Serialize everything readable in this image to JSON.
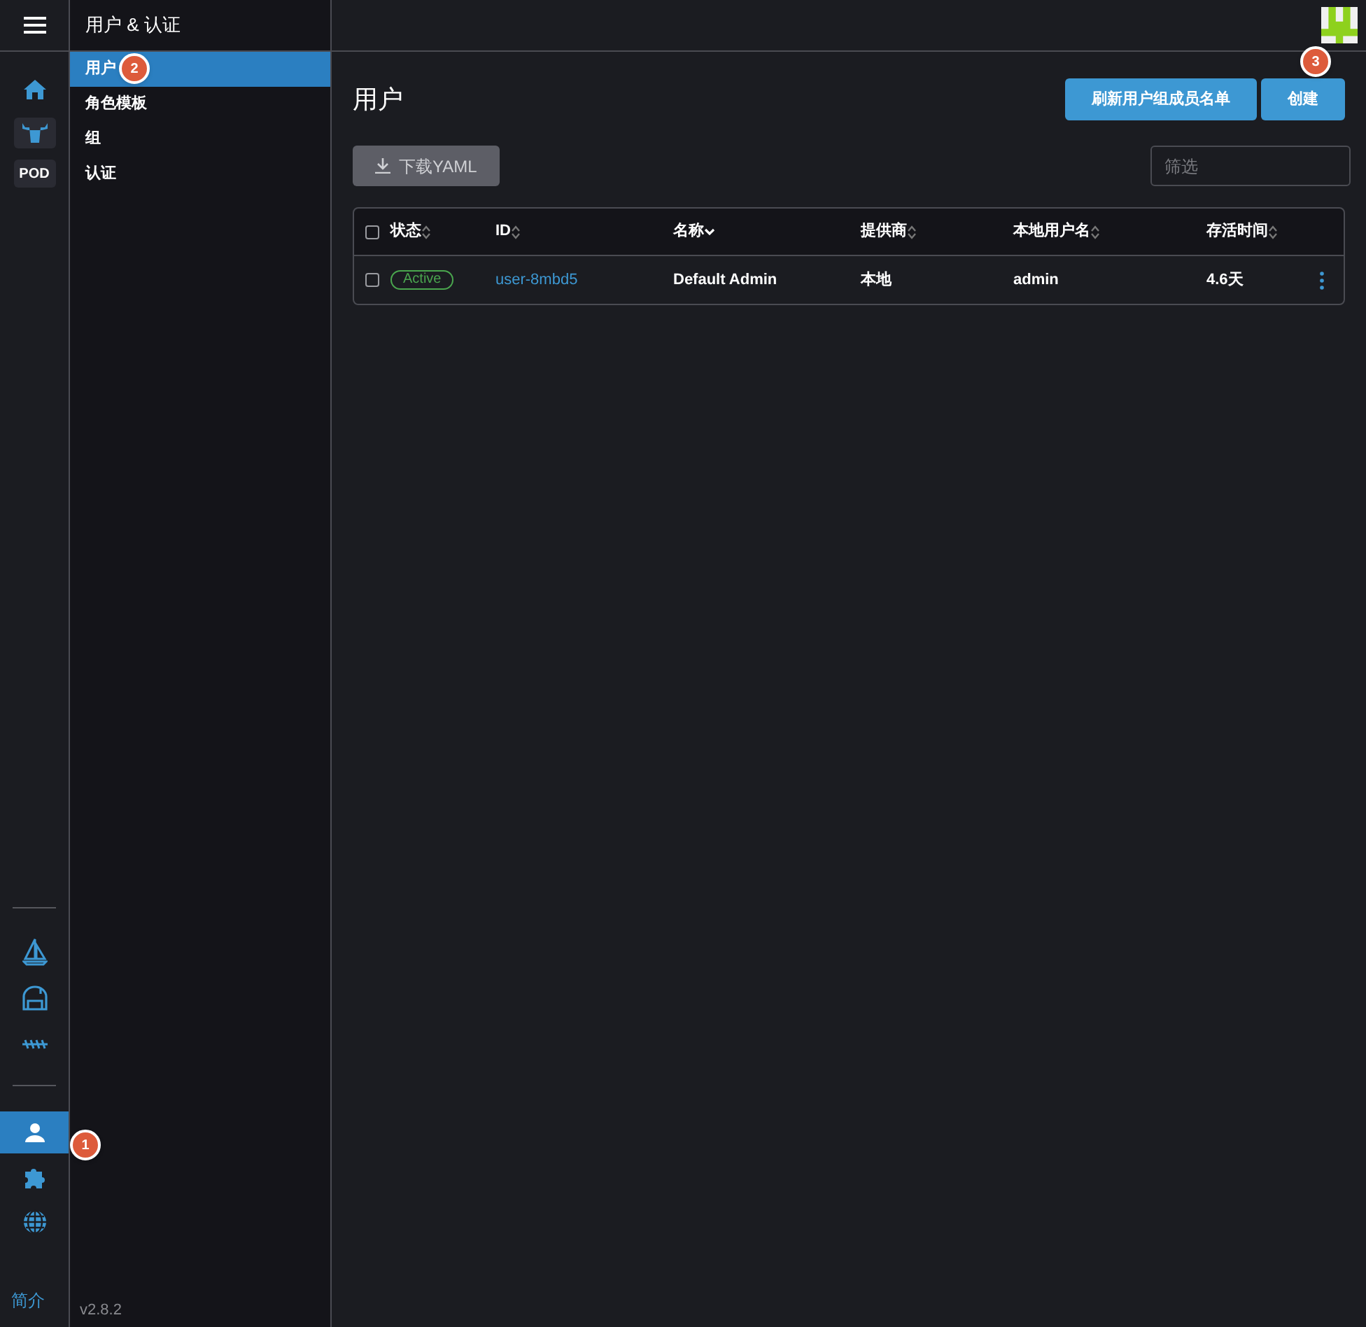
{
  "header": {
    "title": "用户 & 认证"
  },
  "rail": {
    "top": [
      {
        "kind": "home",
        "selected": false
      },
      {
        "kind": "cow",
        "selected": false
      },
      {
        "kind": "pod",
        "label": "POD",
        "selected": false
      }
    ],
    "middle": [
      {
        "kind": "sail",
        "selected": false
      },
      {
        "kind": "barn",
        "selected": false
      },
      {
        "kind": "rope",
        "selected": false
      }
    ],
    "bottom": [
      {
        "kind": "user",
        "selected": true
      },
      {
        "kind": "puzzle",
        "selected": false
      },
      {
        "kind": "globe",
        "selected": false
      }
    ],
    "about": "简介"
  },
  "sidebar": {
    "items": [
      {
        "label": "用户",
        "selected": true
      },
      {
        "label": "角色模板",
        "selected": false
      },
      {
        "label": "组",
        "selected": false
      },
      {
        "label": "认证",
        "selected": false
      }
    ],
    "version": "v2.8.2"
  },
  "main": {
    "title": "用户",
    "buttons": [
      "刷新用户组成员名单",
      "创建"
    ],
    "download": "下载YAML",
    "filter": {
      "placeholder": "筛选"
    }
  },
  "table": {
    "select_all": false,
    "columns": [
      {
        "label": "状态",
        "sorted": false
      },
      {
        "label": "ID",
        "sorted": false
      },
      {
        "label": "名称",
        "sorted": true
      },
      {
        "label": "提供商",
        "sorted": false
      },
      {
        "label": "本地用户名",
        "sorted": false
      },
      {
        "label": "存活时间",
        "sorted": false
      }
    ],
    "rows": [
      {
        "checked": false,
        "status": "Active",
        "id": "user-8mbd5",
        "name": "Default Admin",
        "provider": "本地",
        "username": "admin",
        "age": "4.6天"
      }
    ]
  },
  "markers": [
    "1",
    "2",
    "3"
  ]
}
